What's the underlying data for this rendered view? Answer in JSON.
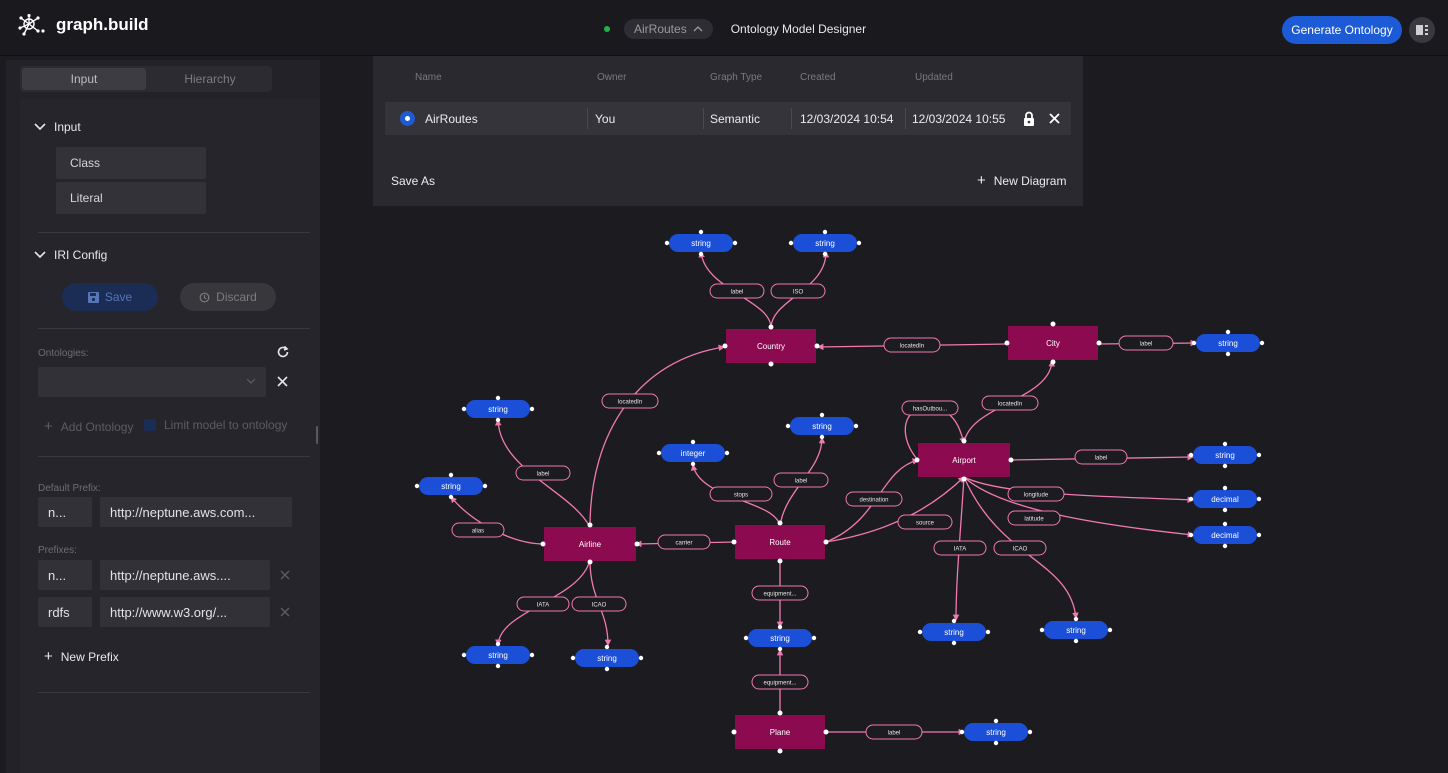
{
  "app": {
    "title": "graph.build",
    "diagram_name": "AirRoutes",
    "page_title": "Ontology Model Designer",
    "generate_button": "Generate Ontology",
    "accent_color": "#1d5bd6",
    "class_color": "#8b0a50",
    "literal_color": "#1c4fd8"
  },
  "sidebar": {
    "tabs": [
      "Input",
      "Hierarchy"
    ],
    "input_section": {
      "title": "Input",
      "items": [
        "Class",
        "Literal"
      ]
    },
    "iri_section": {
      "title": "IRI Config",
      "save": "Save",
      "discard": "Discard",
      "ontologies_label": "Ontologies:",
      "add_ontology": "Add Ontology",
      "limit_label": "Limit model to ontology",
      "default_prefix_label": "Default Prefix:",
      "default_prefix": {
        "prefix": "n...",
        "uri": "http://neptune.aws.com..."
      },
      "prefixes_label": "Prefixes:",
      "prefixes": [
        {
          "prefix": "n...",
          "uri": "http://neptune.aws...."
        },
        {
          "prefix": "rdfs",
          "uri": "http://www.w3.org/..."
        }
      ],
      "new_prefix": "New Prefix"
    }
  },
  "diagram_dropdown": {
    "headers": [
      "Name",
      "Owner",
      "Graph Type",
      "Created",
      "Updated"
    ],
    "row": {
      "name": "AirRoutes",
      "owner": "You",
      "graph_type": "Semantic",
      "created": "12/03/2024 10:54",
      "updated": "12/03/2024 10:55"
    },
    "save_as": "Save As",
    "new_diagram": "New Diagram"
  },
  "graph": {
    "classes": [
      {
        "id": "country",
        "label": "Country"
      },
      {
        "id": "city",
        "label": "City"
      },
      {
        "id": "airport",
        "label": "Airport"
      },
      {
        "id": "airline",
        "label": "Airline"
      },
      {
        "id": "route",
        "label": "Route"
      },
      {
        "id": "plane",
        "label": "Plane"
      }
    ],
    "literals": [
      {
        "id": "l1",
        "label": "string"
      },
      {
        "id": "l2",
        "label": "string"
      },
      {
        "id": "l3",
        "label": "string"
      },
      {
        "id": "l4",
        "label": "string"
      },
      {
        "id": "l5",
        "label": "string"
      },
      {
        "id": "l6",
        "label": "string"
      },
      {
        "id": "l7",
        "label": "integer"
      },
      {
        "id": "l8",
        "label": "string"
      },
      {
        "id": "l9",
        "label": "decimal"
      },
      {
        "id": "l10",
        "label": "decimal"
      },
      {
        "id": "l11",
        "label": "string"
      },
      {
        "id": "l12",
        "label": "string"
      },
      {
        "id": "l13",
        "label": "string"
      },
      {
        "id": "l14",
        "label": "string"
      },
      {
        "id": "l15",
        "label": "string"
      },
      {
        "id": "l16",
        "label": "string"
      }
    ],
    "edges": [
      {
        "from": "country",
        "to": "l1",
        "label": "label"
      },
      {
        "from": "country",
        "to": "l2",
        "label": "ISO"
      },
      {
        "from": "city",
        "to": "country",
        "label": "locatedIn"
      },
      {
        "from": "city",
        "to": "l3",
        "label": "label"
      },
      {
        "from": "airline",
        "to": "country",
        "label": "locatedIn"
      },
      {
        "from": "airline",
        "to": "l4",
        "label": "label"
      },
      {
        "from": "airline",
        "to": "l5",
        "label": "alias"
      },
      {
        "from": "airline",
        "to": "l6",
        "label": "IATA"
      },
      {
        "from": "airline",
        "to": "l16",
        "label": "ICAO"
      },
      {
        "from": "route",
        "to": "l7",
        "label": "stops"
      },
      {
        "from": "route",
        "to": "l8",
        "label": "label"
      },
      {
        "from": "route",
        "to": "airline",
        "label": "carrier"
      },
      {
        "from": "route",
        "to": "airport",
        "label": "destination"
      },
      {
        "from": "route",
        "to": "airport",
        "label": "source"
      },
      {
        "from": "route",
        "to": "l11",
        "label": "equipment..."
      },
      {
        "from": "plane",
        "to": "l11",
        "label": "equipment..."
      },
      {
        "from": "plane",
        "to": "l12",
        "label": "label"
      },
      {
        "from": "airport",
        "to": "city",
        "label": "locatedIn"
      },
      {
        "from": "airport",
        "to": "airport",
        "label": "hasOutbou..."
      },
      {
        "from": "airport",
        "to": "l13",
        "label": "label"
      },
      {
        "from": "airport",
        "to": "l9",
        "label": "longitude"
      },
      {
        "from": "airport",
        "to": "l10",
        "label": "latitude"
      },
      {
        "from": "airport",
        "to": "l14",
        "label": "IATA"
      },
      {
        "from": "airport",
        "to": "l15",
        "label": "ICAO"
      }
    ]
  }
}
